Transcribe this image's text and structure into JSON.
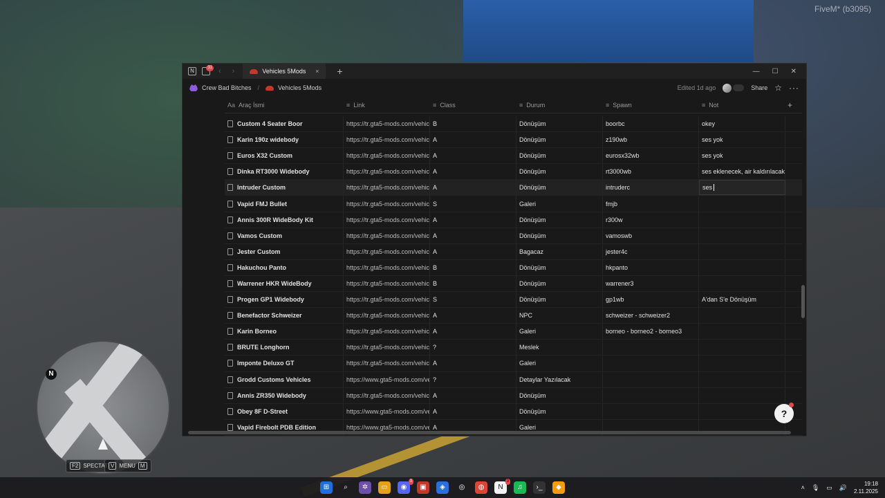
{
  "fivem_label": "FiveM* (b3095)",
  "hud": {
    "compass": "N",
    "spectate_key": "F2",
    "spectate_label": "SPECTATE",
    "menu_key": "V",
    "menu_label": "MENU",
    "menu_key2": "M"
  },
  "window": {
    "tab_title": "Vehicles 5Mods",
    "tab_badge": "31",
    "notion_icon": "N"
  },
  "breadcrumb": {
    "workspace": "Crew Bad Bitches",
    "page": "Vehicles 5Mods"
  },
  "topbar": {
    "edited": "Edited 1d ago",
    "share": "Share"
  },
  "columns": [
    {
      "label": "Araç İsmi",
      "icon": "Aa"
    },
    {
      "label": "Link",
      "icon": "≡"
    },
    {
      "label": "Class",
      "icon": "≡"
    },
    {
      "label": "Durum",
      "icon": "≡"
    },
    {
      "label": "Spawn",
      "icon": "≡"
    },
    {
      "label": "Not",
      "icon": "≡"
    }
  ],
  "rows": [
    {
      "name": "Custom 4 Seater Boor",
      "link": "https://tr.gta5-mods.com/vehic",
      "class": "B",
      "durum": "Dönüşüm",
      "spawn": "boorbc",
      "not": "okey"
    },
    {
      "name": "Karin 190z widebody",
      "link": "https://tr.gta5-mods.com/vehic",
      "class": "A",
      "durum": "Dönüşüm",
      "spawn": "z190wb",
      "not": "ses yok"
    },
    {
      "name": "Euros X32 Custom",
      "link": "https://tr.gta5-mods.com/vehic",
      "class": "A",
      "durum": "Dönüşüm",
      "spawn": "eurosx32wb",
      "not": "ses yok"
    },
    {
      "name": "Dinka RT3000 Widebody",
      "link": "https://tr.gta5-mods.com/vehic",
      "class": "A",
      "durum": "Dönüşüm",
      "spawn": "rt3000wb",
      "not": "ses eklenecek, air kaldırılacak"
    },
    {
      "name": "Intruder Custom",
      "link": "https://tr.gta5-mods.com/vehic",
      "class": "A",
      "durum": "Dönüşüm",
      "spawn": "intruderc",
      "not": "ses"
    },
    {
      "name": "Vapid FMJ Bullet",
      "link": "https://tr.gta5-mods.com/vehic",
      "class": "S",
      "durum": "Galeri",
      "spawn": "fmjb",
      "not": ""
    },
    {
      "name": "Annis 300R WideBody Kit",
      "link": "https://tr.gta5-mods.com/vehic",
      "class": "A",
      "durum": "Dönüşüm",
      "spawn": "r300w",
      "not": ""
    },
    {
      "name": "Vamos Custom",
      "link": "https://tr.gta5-mods.com/vehic",
      "class": "A",
      "durum": "Dönüşüm",
      "spawn": "vamoswb",
      "not": ""
    },
    {
      "name": "Jester Custom",
      "link": "https://tr.gta5-mods.com/vehic",
      "class": "A",
      "durum": "Bagacaz",
      "spawn": "jester4c",
      "not": ""
    },
    {
      "name": "Hakuchou Panto",
      "link": "https://tr.gta5-mods.com/vehic",
      "class": "B",
      "durum": "Dönüşüm",
      "spawn": "hkpanto",
      "not": ""
    },
    {
      "name": "Warrener HKR WideBody",
      "link": "https://tr.gta5-mods.com/vehic",
      "class": "B",
      "durum": "Dönüşüm",
      "spawn": "warrener3",
      "not": ""
    },
    {
      "name": "Progen GP1 Widebody",
      "link": "https://tr.gta5-mods.com/vehic",
      "class": "S",
      "durum": "Dönüşüm",
      "spawn": "gp1wb",
      "not": "A'dan S'e Dönüşüm"
    },
    {
      "name": "Benefactor Schweizer",
      "link": "https://tr.gta5-mods.com/vehic",
      "class": "A",
      "durum": "NPC",
      "spawn": "schweizer - schweizer2",
      "not": ""
    },
    {
      "name": "Karin Borneo",
      "link": "https://tr.gta5-mods.com/vehic",
      "class": "A",
      "durum": "Galeri",
      "spawn": "borneo - borneo2 - borneo3",
      "not": ""
    },
    {
      "name": "BRUTE Longhorn",
      "link": "https://tr.gta5-mods.com/vehic",
      "class": "?",
      "durum": "Meslek",
      "spawn": "",
      "not": ""
    },
    {
      "name": "Imponte Deluxo GT",
      "link": "https://tr.gta5-mods.com/vehic",
      "class": "A",
      "durum": "Galeri",
      "spawn": "",
      "not": ""
    },
    {
      "name": "Grodd Customs Vehicles",
      "link": "https://www.gta5-mods.com/ve",
      "class": "?",
      "durum": "Detaylar Yazılacak",
      "spawn": "",
      "not": ""
    },
    {
      "name": "Annis ZR350 Widebody",
      "link": "https://tr.gta5-mods.com/vehic",
      "class": "A",
      "durum": "Dönüşüm",
      "spawn": "",
      "not": ""
    },
    {
      "name": "Obey 8F D-Street",
      "link": "https://www.gta5-mods.com/ve",
      "class": "A",
      "durum": "Dönüşüm",
      "spawn": "",
      "not": ""
    },
    {
      "name": "Vapid Firebolt PDB Edition",
      "link": "https://www.gta5-mods.com/ve",
      "class": "A",
      "durum": "Galeri",
      "spawn": "",
      "not": ""
    }
  ],
  "taskbar": {
    "time": "19:18",
    "date": "2.11.2025",
    "discord_badge": "3",
    "notion_badge": "3"
  },
  "colors": {
    "accent": "#2a5fa8",
    "window_bg": "#191919",
    "taskbar_bg": "#1c1c1e"
  }
}
